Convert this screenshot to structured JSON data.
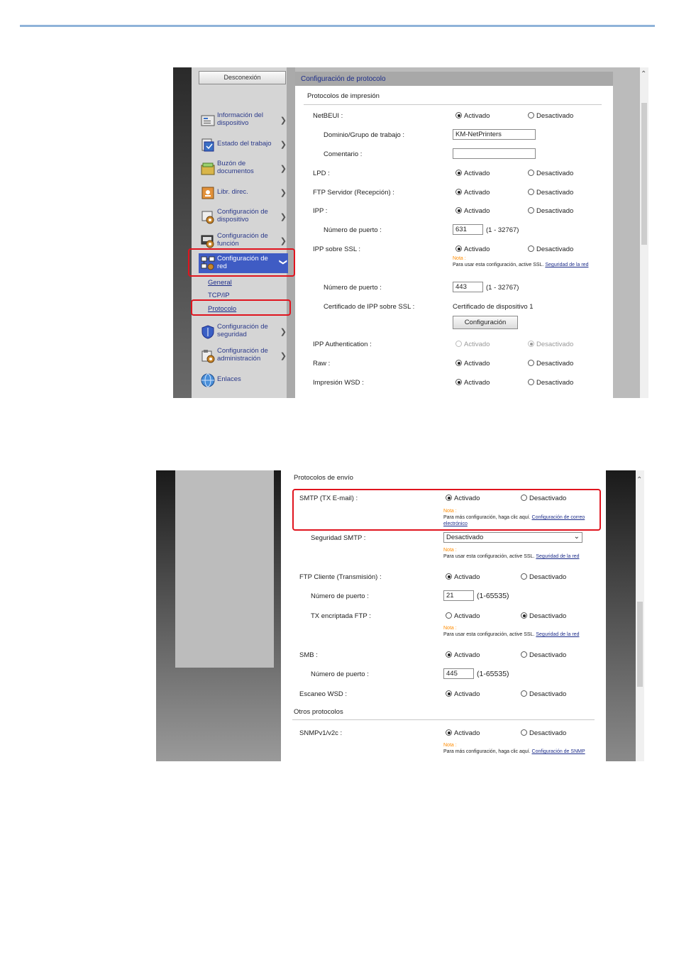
{
  "screenshot1": {
    "logout_label": "Desconexión",
    "nav": [
      {
        "label": "Información del dispositivo",
        "icon": "device-info-icon"
      },
      {
        "label": "Estado del trabajo",
        "icon": "job-status-icon"
      },
      {
        "label": "Buzón de documentos",
        "icon": "document-box-icon"
      },
      {
        "label": "Libr. direc.",
        "icon": "address-book-icon"
      },
      {
        "label": "Configuración de dispositivo",
        "icon": "device-settings-icon"
      },
      {
        "label": "Configuración de función",
        "icon": "function-settings-icon"
      },
      {
        "label": "Configuración de red",
        "icon": "network-settings-icon"
      },
      {
        "label": "Configuración de seguridad",
        "icon": "security-settings-icon"
      },
      {
        "label": "Configuración de administración",
        "icon": "management-settings-icon"
      },
      {
        "label": "Enlaces",
        "icon": "links-globe-icon"
      }
    ],
    "subnav": [
      "General",
      "TCP/IP",
      "Protocolo"
    ],
    "panel_title": "Configuración de protocolo",
    "section_title": "Protocolos de impresión",
    "on_label": "Activado",
    "off_label": "Desactivado",
    "rows": {
      "netbeui": "NetBEUI :",
      "domain": "Dominio/Grupo de trabajo :",
      "domain_value": "KM-NetPrinters",
      "comment": "Comentario :",
      "comment_value": "",
      "lpd": "LPD :",
      "ftp_server": "FTP Servidor (Recepción) :",
      "ipp": "IPP :",
      "ipp_port": "Número de puerto :",
      "ipp_port_value": "631",
      "ipp_range": "(1 - 32767)",
      "ipp_ssl": "IPP sobre SSL :",
      "ipp_ssl_note_word": "Nota :",
      "ipp_ssl_note": "Para usar esta configuración, active SSL.",
      "ipp_ssl_note_link": "Seguridad de la red",
      "ssl_port": "Número de puerto :",
      "ssl_port_value": "443",
      "ssl_range": "(1 - 32767)",
      "cert": "Certificado de IPP sobre SSL :",
      "cert_value": "Certificado de dispositivo 1",
      "config_button": "Configuración",
      "ipp_auth": "IPP Authentication :",
      "raw": "Raw :",
      "wsd_print": "Impresión WSD :"
    }
  },
  "screenshot2": {
    "section_send": "Protocolos de envío",
    "section_other": "Otros protocolos",
    "on_label": "Activado",
    "off_label": "Desactivado",
    "note_word": "Nota :",
    "rows": {
      "smtp": "SMTP (TX E-mail) :",
      "smtp_note": "Para más configuración, haga clic aquí.",
      "smtp_note_link": "Configuración de correo electrónico",
      "smtp_security": "Seguridad SMTP :",
      "smtp_security_value": "Desactivado",
      "smtp_security_note": "Para usar esta configuración, active SSL.",
      "smtp_security_note_link": "Seguridad de la red",
      "ftp_client": "FTP Cliente (Transmisión) :",
      "ftp_port": "Número de puerto :",
      "ftp_port_value": "21",
      "ftp_range": "(1-65535)",
      "ftp_encrypted": "TX encriptada FTP :",
      "ftp_encrypted_note": "Para usar esta configuración, active SSL.",
      "ftp_encrypted_note_link": "Seguridad de la red",
      "smb": "SMB :",
      "smb_port": "Número de puerto :",
      "smb_port_value": "445",
      "smb_range": "(1-65535)",
      "wsd_scan": "Escaneo WSD :",
      "snmp": "SNMPv1/v2c :",
      "snmp_note": "Para más configuración, haga clic aquí.",
      "snmp_note_link": "Configuración de SNMP"
    }
  },
  "colors": {
    "highlight": "#e0141e",
    "link": "#1d2d8a",
    "note": "#ff8c00",
    "nav_active": "#3f5cc4"
  }
}
